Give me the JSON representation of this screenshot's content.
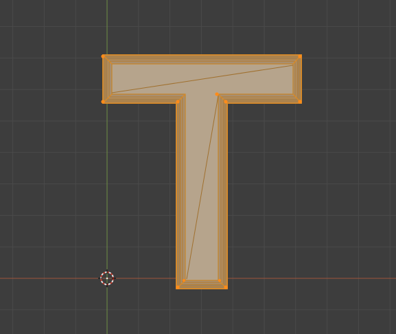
{
  "viewport": {
    "type": "3d-viewport-top-orthographic",
    "background_color": "#3d3d3d",
    "grid_color": "#4a4a4a",
    "x_axis_color": "#9b5a3c",
    "y_axis_color": "#6e8a45"
  },
  "object": {
    "name": "text-mesh-T",
    "mode": "edit",
    "all_selected": true,
    "face_color": "#b6a48c",
    "edge_color": "#d68a2a",
    "vertex_color": "#ff8c1a"
  },
  "cursor": {
    "icon": "3d-cursor-icon",
    "ring_color": "#e0e0e0",
    "dash_color": "#c0392b"
  }
}
